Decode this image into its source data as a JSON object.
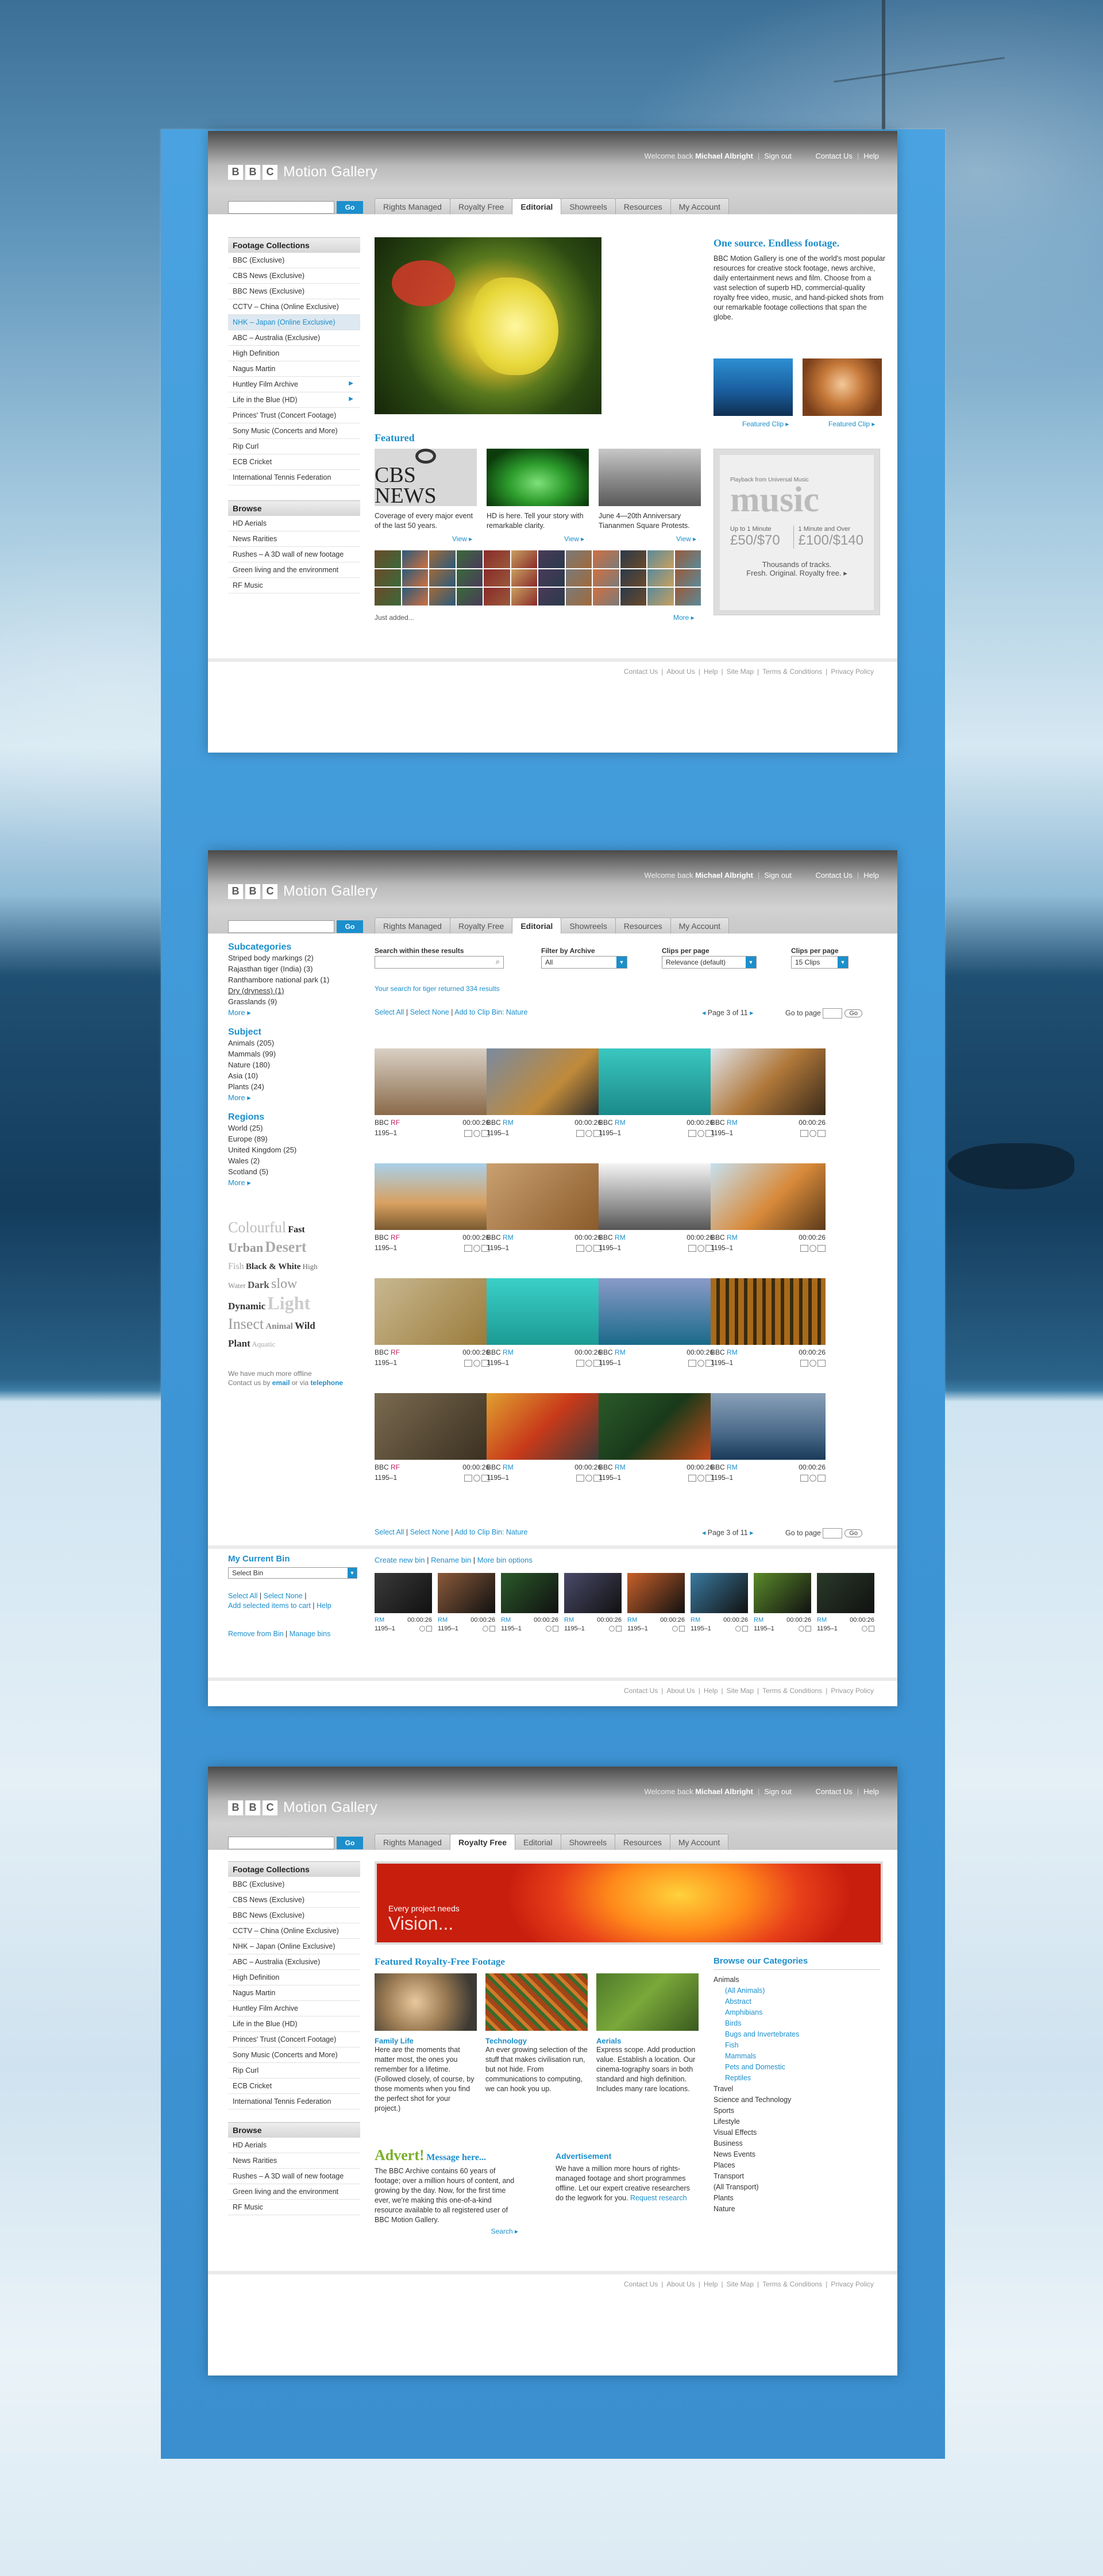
{
  "header": {
    "welcome": "Welcome back",
    "user": "Michael Albright",
    "signout": "Sign out",
    "contact": "Contact Us",
    "help": "Help",
    "brand": "Motion Gallery",
    "go": "Go",
    "tabs": [
      "Rights Managed",
      "Royalty Free",
      "Editorial",
      "Showreels",
      "Resources",
      "My Account"
    ]
  },
  "colors": {
    "accent": "#1c8fcc",
    "rf_badge": "#c2185b",
    "rm_badge": "#1c8fcc"
  },
  "footer": [
    "Contact Us",
    "About Us",
    "Help",
    "Site Map",
    "Terms & Conditions",
    "Privacy Policy"
  ],
  "page1": {
    "collections_title": "Footage Collections",
    "collections": [
      "BBC (Exclusive)",
      "CBS News (Exclusive)",
      "BBC News (Exclusive)",
      "CCTV – China (Online Exclusive)",
      "NHK – Japan (Online Exclusive)",
      "ABC – Australia (Exclusive)",
      "High Definition",
      "Nagus Martin",
      "Huntley Film Archive",
      "Life in the Blue (HD)",
      "Princes' Trust (Concert Footage)",
      "Sony Music (Concerts and More)",
      "Rip Curl",
      "ECB Cricket",
      "International Tennis Federation"
    ],
    "browse_title": "Browse",
    "browse": [
      "HD Aerials",
      "News Rarities",
      "Rushes – A 3D wall of new footage",
      "Green living and the environment",
      "RF Music"
    ],
    "promo_title": "One source. Endless footage.",
    "promo_text": "BBC Motion Gallery is one of the world's most popular resources for creative stock footage, news archive, daily entertainment news and film. Choose from a vast selection of superb HD, commercial-quality royalty free video, music, and hand-picked shots from our remarkable footage collections that span the globe.",
    "featured_clip": "Featured Clip",
    "featured_title": "Featured",
    "featured": [
      {
        "logo": "CBS NEWS",
        "text": "Coverage of every major event of the last 50 years."
      },
      {
        "text": "HD is here. Tell your story with remarkable clarity."
      },
      {
        "text": "June 4—20th Anniversary Tiananmen Square Protests."
      }
    ],
    "view": "View",
    "just_added": "Just added...",
    "more": "More",
    "music": {
      "from": "Playback from Universal Music",
      "word": "music",
      "p1_label": "Up to 1 Minute",
      "p1_price": "£50/$70",
      "p2_label": "1 Minute and Over",
      "p2_price": "£100/$140",
      "tag1": "Thousands of tracks.",
      "tag2": "Fresh. Original. Royalty free."
    }
  },
  "page2": {
    "subcat_title": "Subcategories",
    "subcats": [
      "Striped body markings (2)",
      "Rajasthan tiger (India) (3)",
      "Ranthambore national park (1)",
      "Dry (dryness) (1)",
      "Grasslands (9)"
    ],
    "subject_title": "Subject",
    "subjects": [
      "Animals (205)",
      "Mammals (99)",
      "Nature (180)",
      "Asia (10)",
      "Plants (24)"
    ],
    "regions_title": "Regions",
    "regions": [
      "World (25)",
      "Europe (89)",
      "United Kingdom (25)",
      "Wales (2)",
      "Scotland (5)"
    ],
    "more": "More",
    "tags": [
      "Colourful",
      "Fast",
      "Urban",
      "Desert",
      "Fish",
      "Black & White",
      "High",
      "Water",
      "Dark",
      "slow",
      "Dynamic",
      "Light",
      "Insect",
      "Animal",
      "Wild",
      "Plant",
      "Aquatic"
    ],
    "offline_note": "We have much more offline",
    "offline_contact": "Contact us by",
    "offline_email": "email",
    "offline_or": "or via",
    "offline_phone": "telephone",
    "search_label": "Search within these results",
    "filter_label": "Filter by Archive",
    "filter_value": "All",
    "clips_label": "Clips per page",
    "clips_sort": "Relevance (default)",
    "clips_count_label": "Clips per page",
    "clips_count": "15 Clips",
    "result_text": "Your search for tiger returned 334 results",
    "select_all": "Select All",
    "select_none": "Select None",
    "add_bin": "Add to Clip Bin: Nature",
    "page_info": "Page 3 of 11",
    "go_to_page": "Go to page",
    "go": "Go",
    "clips": [
      {
        "lic": "RF",
        "dur": "00:00:26",
        "id": "1195–1"
      },
      {
        "lic": "RM",
        "dur": "00:00:26",
        "id": "1195–1"
      },
      {
        "lic": "RM",
        "dur": "00:00:26",
        "id": "1195–1"
      },
      {
        "lic": "RM",
        "dur": "00:00:26",
        "id": "1195–1"
      },
      {
        "lic": "RF",
        "dur": "00:00:26",
        "id": "1195–1"
      },
      {
        "lic": "RM",
        "dur": "00:00:26",
        "id": "1195–1"
      },
      {
        "lic": "RM",
        "dur": "00:00:26",
        "id": "1195–1"
      },
      {
        "lic": "RM",
        "dur": "00:00:26",
        "id": "1195–1"
      },
      {
        "lic": "RF",
        "dur": "00:00:26",
        "id": "1195–1"
      },
      {
        "lic": "RM",
        "dur": "00:00:26",
        "id": "1195–1"
      },
      {
        "lic": "RM",
        "dur": "00:00:26",
        "id": "1195–1"
      },
      {
        "lic": "RM",
        "dur": "00:00:26",
        "id": "1195–1"
      },
      {
        "lic": "RF",
        "dur": "00:00:26",
        "id": "1195–1"
      },
      {
        "lic": "RM",
        "dur": "00:00:26",
        "id": "1195–1"
      },
      {
        "lic": "RM",
        "dur": "00:00:26",
        "id": "1195–1"
      },
      {
        "lic": "RM",
        "dur": "00:00:26",
        "id": "1195–1"
      }
    ],
    "bin_title": "My Current Bin",
    "bin_select": "Select Bin",
    "bin_select_all": "Select All",
    "bin_select_none": "Select None",
    "bin_add_cart": "Add selected items to cart",
    "bin_help": "Help",
    "bin_remove": "Remove from Bin",
    "bin_manage": "Manage bins",
    "bin_create": "Create new bin",
    "bin_rename": "Rename bin",
    "bin_more": "More bin options",
    "bin_clips": [
      {
        "lic": "RM",
        "dur": "00:00:26",
        "id": "1195–1"
      },
      {
        "lic": "RM",
        "dur": "00:00:26",
        "id": "1195–1"
      },
      {
        "lic": "RM",
        "dur": "00:00:26",
        "id": "1195–1"
      },
      {
        "lic": "RM",
        "dur": "00:00:26",
        "id": "1195–1"
      },
      {
        "lic": "RM",
        "dur": "00:00:26",
        "id": "1195–1"
      },
      {
        "lic": "RM",
        "dur": "00:00:26",
        "id": "1195–1"
      },
      {
        "lic": "RM",
        "dur": "00:00:26",
        "id": "1195–1"
      },
      {
        "lic": "RM",
        "dur": "00:00:26",
        "id": "1195–1"
      }
    ]
  },
  "page3": {
    "banner_small": "Every project needs",
    "banner_big": "Vision...",
    "rf_title": "Featured Royalty-Free Footage",
    "rf": [
      {
        "title": "Family Life",
        "text": "Here are the moments that matter most, the ones you remember for a lifetime. (Followed closely, of course, by those moments when you find the perfect shot for your project.)"
      },
      {
        "title": "Technology",
        "text": "An ever growing selection of the stuff that makes civilisation run, but not hide. From communications to computing, we can hook you up."
      },
      {
        "title": "Aerials",
        "text": "Express scope. Add production value. Establish a location. Our cinema-tography soars in both standard and high definition. Includes many rare locations."
      }
    ],
    "advert_big": "Advert!",
    "advert_small": "Message here...",
    "advert_text": "The BBC Archive contains 60 years of footage; over a million hours of content, and growing by the day. Now, for the first time ever, we're making this one-of-a-kind resource available to all registered user of BBC Motion Gallery.",
    "search_link": "Search",
    "ad_title": "Advertisement",
    "ad_text": "We have a million more hours of rights-managed footage and short programmes offline. Let our expert creative researchers do the legwork for you.",
    "ad_link": "Request research",
    "browse_title": "Browse our Categories",
    "cat_animals": "Animals",
    "animal_sub": [
      "(All Animals)",
      "Abstract",
      "Amphibians",
      "Birds",
      "Bugs and Invertebrates",
      "Fish",
      "Mammals",
      "Pets and Domestic",
      "Reptiles"
    ],
    "categories": [
      "Travel",
      "Science and Technology",
      "Sports",
      "Lifestyle",
      "Visual Effects",
      "Business",
      "News Events",
      "Places",
      "Transport",
      "(All Transport)",
      "Plants",
      "Nature"
    ]
  }
}
